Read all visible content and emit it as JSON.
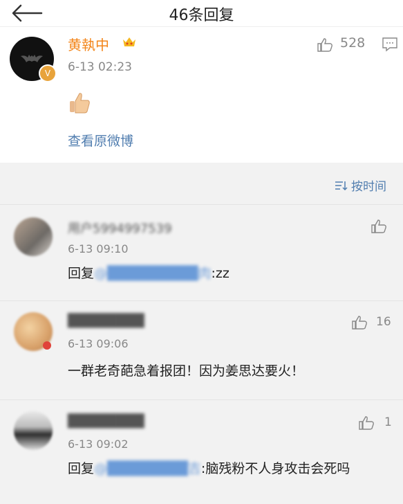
{
  "header": {
    "title": "46条回复"
  },
  "original": {
    "username": "黄執中",
    "time": "6-13 02:23",
    "likes": "528",
    "view_link": "查看原微博"
  },
  "sort": {
    "label": "按时间"
  },
  "replies": [
    {
      "username": "用户5994997539",
      "time": "6-13 09:10",
      "reply_prefix": "回复",
      "mention": "@█████████肉",
      "text": ":zz",
      "likes": ""
    },
    {
      "username": "████████",
      "time": "6-13 09:06",
      "text": "一群老奇葩急着报团！因为姜思达要火！",
      "likes": "16"
    },
    {
      "username": "████████",
      "time": "6-13 09:02",
      "reply_prefix": "回复",
      "mention": "@████████吉",
      "text": ":脑残粉不人身攻击会死吗",
      "likes": "1"
    }
  ]
}
